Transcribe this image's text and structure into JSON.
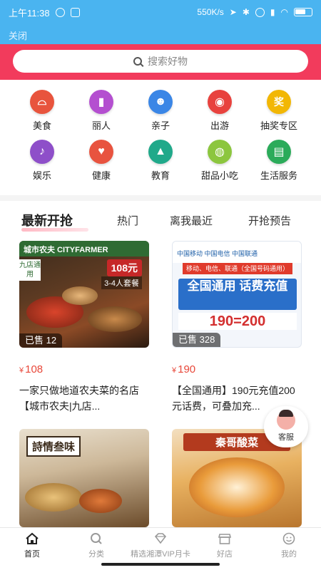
{
  "status_bar": {
    "time": "上午11:38",
    "speed": "550K/s"
  },
  "title_bar": {
    "close_label": "关闭"
  },
  "search": {
    "placeholder": "搜索好物"
  },
  "categories": [
    {
      "label": "美食",
      "color": "#e8543d",
      "icon": "cloche-icon"
    },
    {
      "label": "丽人",
      "color": "#b44fd0",
      "icon": "lipstick-icon"
    },
    {
      "label": "亲子",
      "color": "#3a86e6",
      "icon": "family-icon"
    },
    {
      "label": "出游",
      "color": "#e8423e",
      "icon": "camera-icon"
    },
    {
      "label": "抽奖专区",
      "color": "#f2b705",
      "icon": "prize-icon"
    },
    {
      "label": "娱乐",
      "color": "#8e4fc9",
      "icon": "microphone-icon"
    },
    {
      "label": "健康",
      "color": "#e8533f",
      "icon": "heart-hand-icon"
    },
    {
      "label": "教育",
      "color": "#20a98a",
      "icon": "graduation-cap-icon"
    },
    {
      "label": "甜品小吃",
      "color": "#8cc63e",
      "icon": "dessert-icon"
    },
    {
      "label": "生活服务",
      "color": "#2bab5a",
      "icon": "basket-icon"
    }
  ],
  "tabs": [
    {
      "label": "最新开抢"
    },
    {
      "label": "热门"
    },
    {
      "label": "离我最近"
    },
    {
      "label": "开抢预告"
    }
  ],
  "products": [
    {
      "sold": "已售 12",
      "price": "108",
      "currency": "¥",
      "desc": "一家只做地道农夫菜的名店【城市农夫|九店...",
      "image_texts": {
        "brand": "城市农夫 CITYFARMER",
        "badge": "九店通用",
        "price_tag": "108元",
        "set_name": "3-4人套餐"
      }
    },
    {
      "sold": "已售 328",
      "price": "190",
      "currency": "¥",
      "desc": "【全国通用】190元充值200元话费，可叠加充...",
      "image_texts": {
        "carriers": "中国移动  中国电信  中国联通",
        "ribbon": "移动、电信、联通（全国号码通用）",
        "headline": "全国通用 话费充值",
        "amount": "190=200"
      }
    },
    {
      "image_texts": {
        "title": "詩情叁味"
      }
    },
    {
      "image_texts": {
        "title": "秦哥酸菜"
      }
    }
  ],
  "service": {
    "label": "客服"
  },
  "bottom_nav": [
    {
      "label": "首页",
      "icon": "home-icon"
    },
    {
      "label": "分类",
      "icon": "search-icon"
    },
    {
      "label": "精选湘潭VIP月卡",
      "icon": "diamond-icon"
    },
    {
      "label": "好店",
      "icon": "store-icon"
    },
    {
      "label": "我的",
      "icon": "smiley-icon"
    }
  ]
}
